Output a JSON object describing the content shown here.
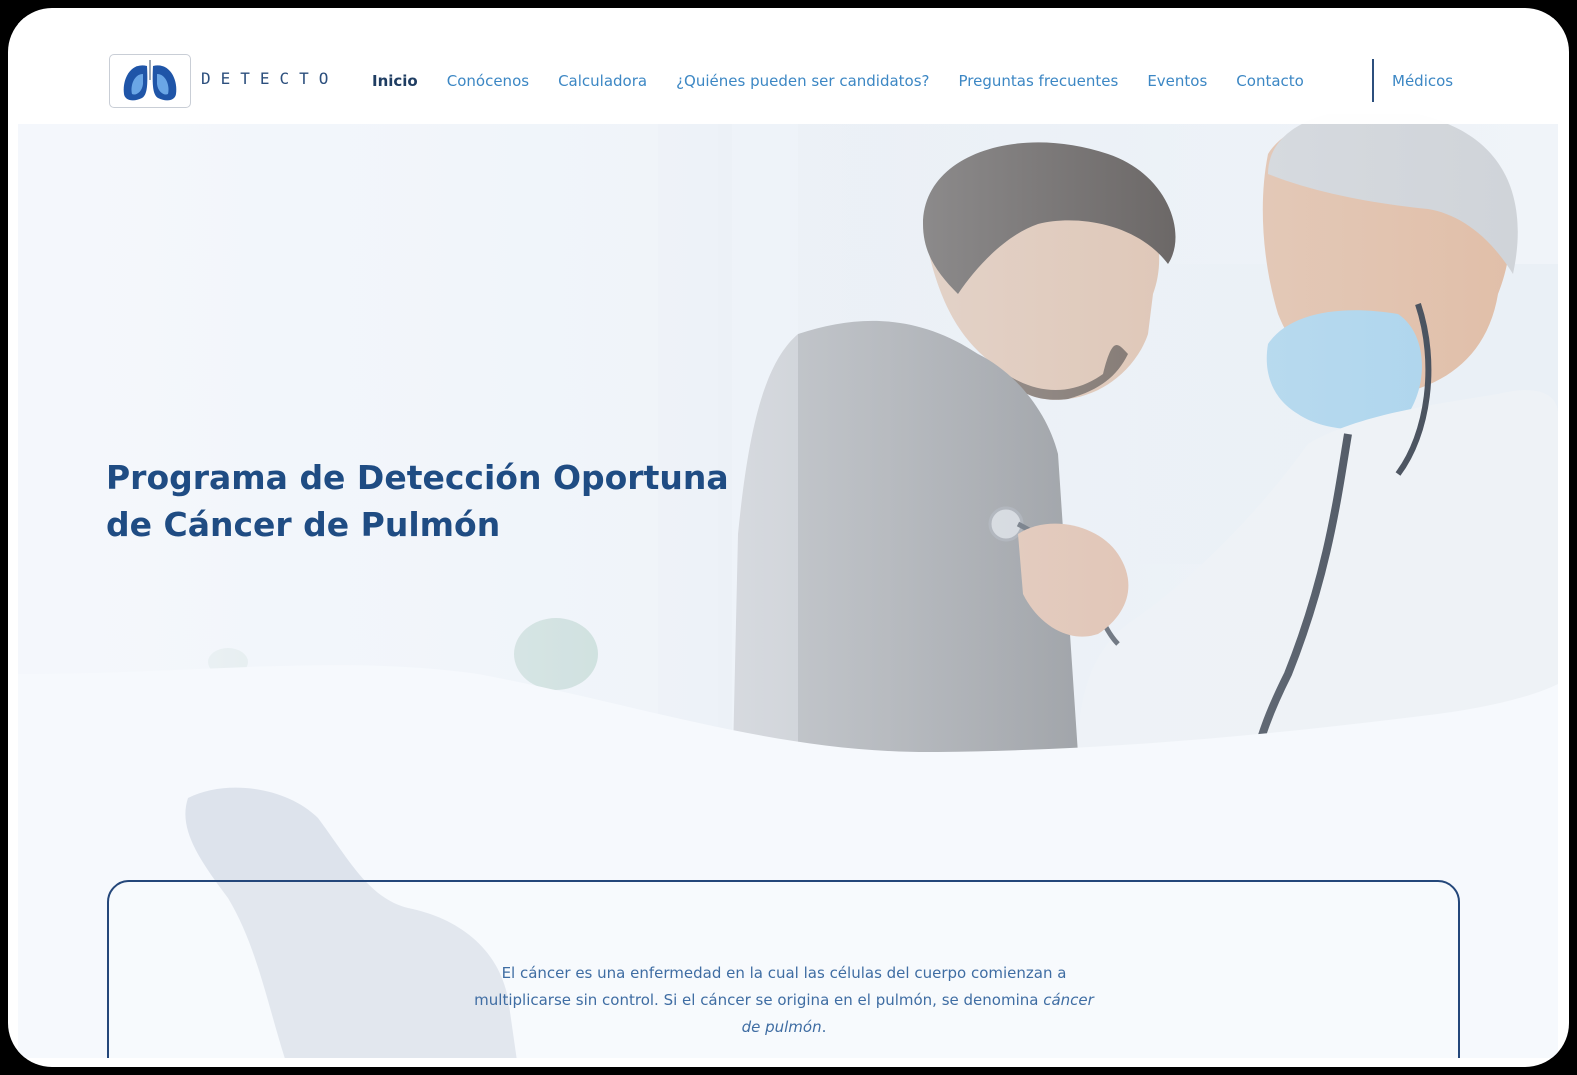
{
  "brand": {
    "name": "DETECTO"
  },
  "nav": {
    "items": [
      {
        "label": "Inicio",
        "active": true
      },
      {
        "label": "Conócenos",
        "active": false
      },
      {
        "label": "Calculadora",
        "active": false
      },
      {
        "label": "¿Quiénes pueden ser candidatos?",
        "active": false
      },
      {
        "label": "Preguntas frecuentes",
        "active": false
      },
      {
        "label": "Eventos",
        "active": false
      },
      {
        "label": "Contacto",
        "active": false
      }
    ],
    "medicos_label": "Médicos"
  },
  "hero": {
    "title_line1": "Programa de Detección Oportuna",
    "title_line2": "de Cáncer de Pulmón",
    "image": "doctor-examining-patient-with-stethoscope"
  },
  "intro": {
    "text_before": "El cáncer es una enfermedad en la cual las células del cuerpo comienzan a multiplicarse sin control. Si el cáncer se origina en el pulmón, se denomina ",
    "text_emphasis": "cáncer de pulmón",
    "text_after": "."
  },
  "colors": {
    "primary_dark": "#1f4c83",
    "link": "#3c87c4",
    "border": "#24477a",
    "background": "#f6f9fd"
  }
}
